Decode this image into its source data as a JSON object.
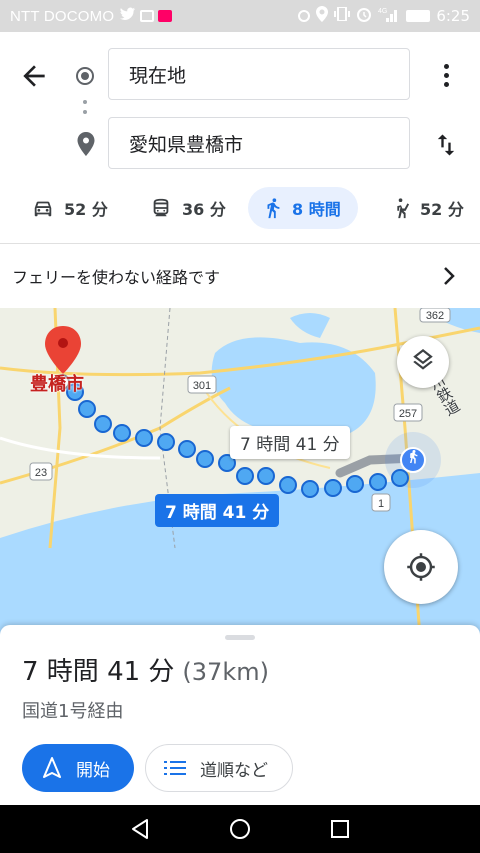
{
  "status_bar": {
    "carrier": "NTT DOCOMO",
    "time": "6:25",
    "network": "4G"
  },
  "search": {
    "origin": "現在地",
    "destination": "愛知県豊橋市"
  },
  "modes": [
    {
      "mode": "car",
      "icon": "car-icon",
      "time": "52 分"
    },
    {
      "mode": "transit",
      "icon": "bus-icon",
      "time": "36 分"
    },
    {
      "mode": "walk",
      "icon": "walk-icon",
      "time": "8 時間",
      "selected": true
    },
    {
      "mode": "ride",
      "icon": "ride-hail-icon",
      "time": "52 分"
    }
  ],
  "notice": "フェリーを使わない経路です",
  "map": {
    "city": "豊橋市",
    "route_main_label": "7 時間 41 分",
    "route_alt_label": "7 時間 41 分",
    "rail_label": "遠州鉄道",
    "road_shields": [
      "301",
      "257",
      "23",
      "1",
      "362"
    ]
  },
  "summary": {
    "duration": "7 時間 41 分",
    "distance": "(37km)",
    "via": "国道1号経由",
    "start_label": "開始",
    "steps_label": "道順など"
  },
  "colors": {
    "accent": "#1a73e8",
    "water": "#aadaff",
    "route_dot": "#4fa8f2",
    "pin": "#ea4335"
  }
}
